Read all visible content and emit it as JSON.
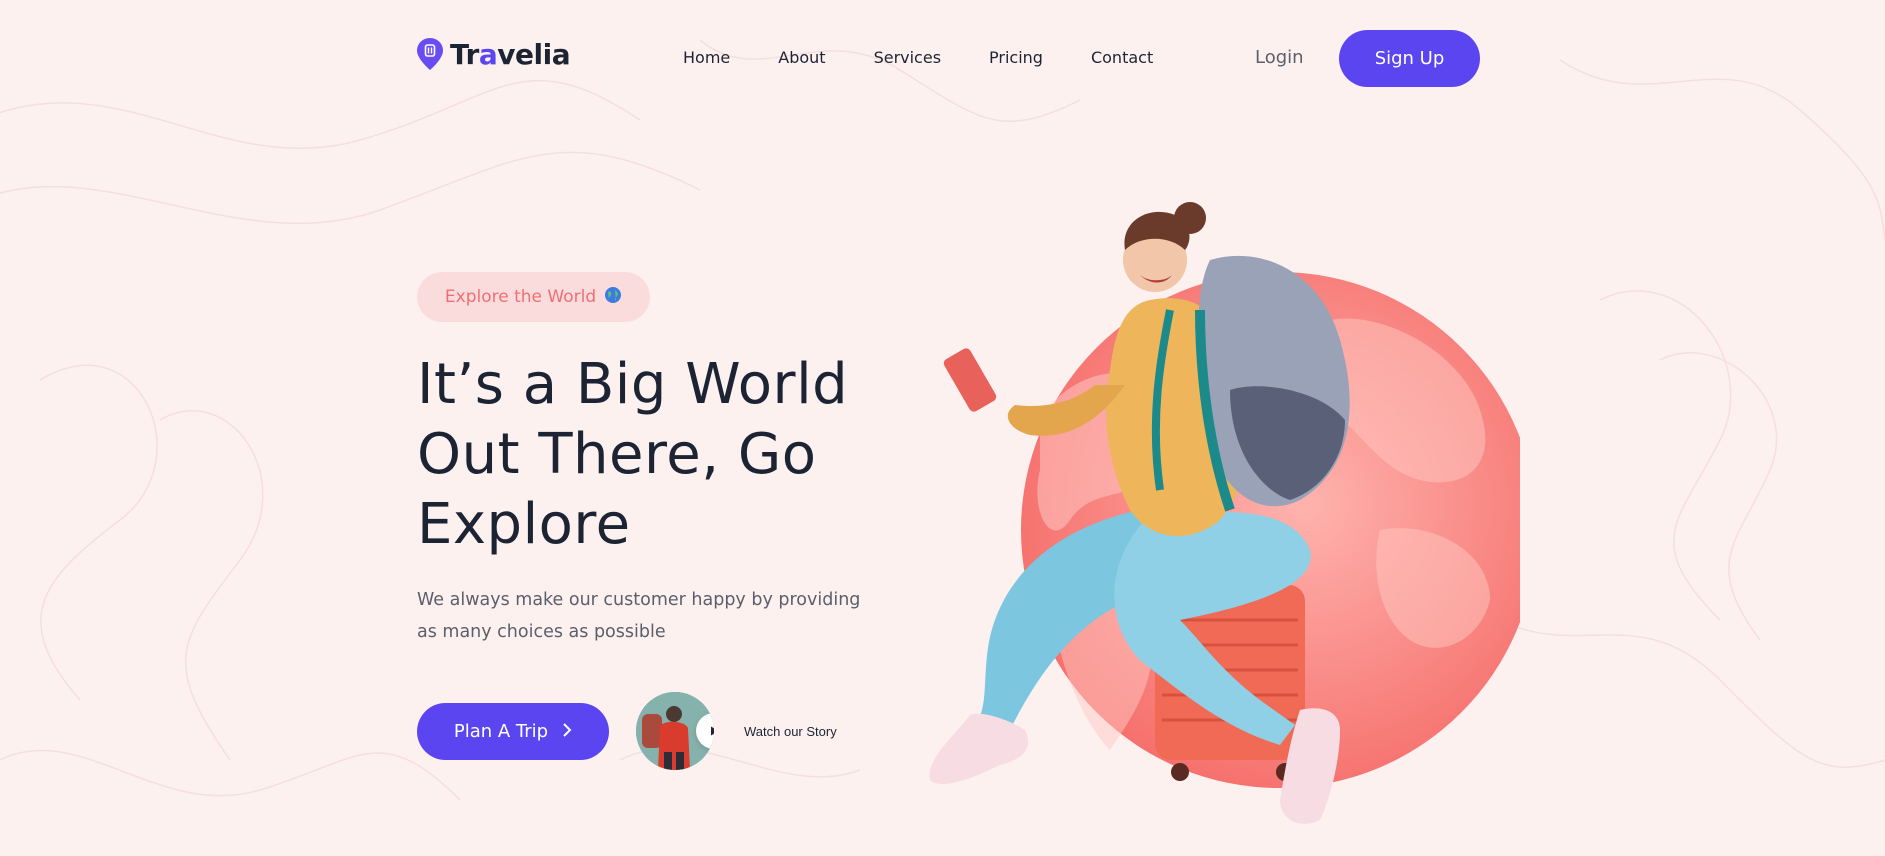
{
  "brand": {
    "name_prefix": "Tr",
    "name_accent": "a",
    "name_suffix": "velia",
    "accent_color": "#5b45f0"
  },
  "nav": {
    "items": [
      {
        "label": "Home"
      },
      {
        "label": "About"
      },
      {
        "label": "Services"
      },
      {
        "label": "Pricing"
      },
      {
        "label": "Contact"
      }
    ],
    "login_label": "Login",
    "signup_label": "Sign Up"
  },
  "hero": {
    "badge_label": "Explore the World",
    "badge_icon": "globe-icon",
    "headline_lines": [
      "It’s a Big World",
      "Out There, Go",
      "Explore"
    ],
    "subtext_lines": [
      "We always make our customer happy by providing",
      "as many choices as possible"
    ],
    "cta_label": "Plan A Trip",
    "cta_icon": "chevron-right-icon",
    "story_label": "Watch our Story",
    "story_icon": "play-icon"
  },
  "colors": {
    "background": "#fdf1f0",
    "primary": "#5b45f0",
    "badge_bg": "#fbdcdc",
    "badge_text": "#ef6f74",
    "globe": "#f87b79",
    "heading": "#1c2434"
  }
}
